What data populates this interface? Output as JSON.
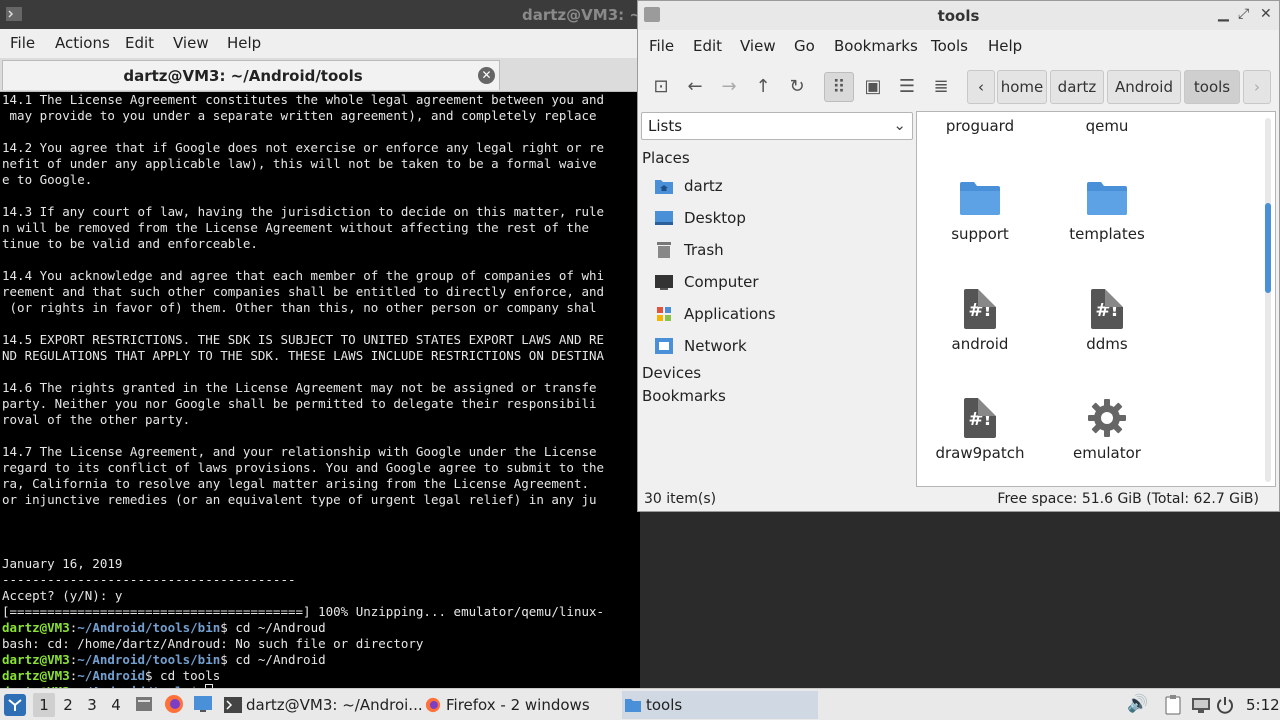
{
  "terminal": {
    "title": "dartz@VM3: ~",
    "menu": [
      "File",
      "Actions",
      "Edit",
      "View",
      "Help"
    ],
    "tab_label": "dartz@VM3: ~/Android/tools",
    "lines": [
      "14.1 The License Agreement constitutes the whole legal agreement between you and",
      " may provide to you under a separate written agreement), and completely replace",
      "",
      "14.2 You agree that if Google does not exercise or enforce any legal right or re",
      "nefit of under any applicable law), this will not be taken to be a formal waive",
      "e to Google.",
      "",
      "14.3 If any court of law, having the jurisdiction to decide on this matter, rule",
      "n will be removed from the License Agreement without affecting the rest of the",
      "tinue to be valid and enforceable.",
      "",
      "14.4 You acknowledge and agree that each member of the group of companies of whi",
      "reement and that such other companies shall be entitled to directly enforce, and",
      " (or rights in favor of) them. Other than this, no other person or company shal",
      "",
      "14.5 EXPORT RESTRICTIONS. THE SDK IS SUBJECT TO UNITED STATES EXPORT LAWS AND RE",
      "ND REGULATIONS THAT APPLY TO THE SDK. THESE LAWS INCLUDE RESTRICTIONS ON DESTINA",
      "",
      "14.6 The rights granted in the License Agreement may not be assigned or transfe",
      "party. Neither you nor Google shall be permitted to delegate their responsibili",
      "roval of the other party.",
      "",
      "14.7 The License Agreement, and your relationship with Google under the License",
      "regard to its conflict of laws provisions. You and Google agree to submit to the",
      "ra, California to resolve any legal matter arising from the License Agreement.",
      "or injunctive remedies (or an equivalent type of urgent legal relief) in any ju",
      "",
      "",
      "",
      "January 16, 2019",
      "---------------------------------------",
      "Accept? (y/N): y",
      "[=======================================] 100% Unzipping... emulator/qemu/linux-"
    ],
    "prompt_user": "dartz@VM3",
    "prompts": [
      {
        "path": "~/Android/tools/bin",
        "cmd": " cd ~/Androud"
      },
      {
        "path": "",
        "cmd": "bash: cd: /home/dartz/Androud: No such file or directory",
        "plain": true
      },
      {
        "path": "~/Android/tools/bin",
        "cmd": " cd ~/Android"
      },
      {
        "path": "~/Android",
        "cmd": " cd tools"
      },
      {
        "path": "~/Android/tools",
        "cmd": " "
      }
    ]
  },
  "filemanager": {
    "title": "tools",
    "menu": [
      "File",
      "Edit",
      "View",
      "Go",
      "Bookmarks",
      "Tools",
      "Help"
    ],
    "breadcrumbs": [
      "home",
      "dartz",
      "Android",
      "tools"
    ],
    "sidebar_view": "Lists",
    "sections": {
      "places": "Places",
      "devices": "Devices",
      "bookmarks": "Bookmarks"
    },
    "places": [
      "dartz",
      "Desktop",
      "Trash",
      "Computer",
      "Applications",
      "Network"
    ],
    "items": [
      {
        "name": "proguard",
        "kind": "folder"
      },
      {
        "name": "qemu",
        "kind": "folder"
      },
      {
        "name": "support",
        "kind": "folder"
      },
      {
        "name": "templates",
        "kind": "folder"
      },
      {
        "name": "android",
        "kind": "script"
      },
      {
        "name": "ddms",
        "kind": "script"
      },
      {
        "name": "draw9patch",
        "kind": "script"
      },
      {
        "name": "emulator",
        "kind": "gear"
      }
    ],
    "script_glyph": "#!",
    "status_count": "30 item(s)",
    "status_space": "Free space: 51.6 GiB (Total: 62.7 GiB)"
  },
  "taskbar": {
    "workspaces": [
      "1",
      "2",
      "3",
      "4"
    ],
    "tasks": [
      {
        "label": "dartz@VM3: ~/Androi...",
        "icon": "terminal-icon"
      },
      {
        "label": "Firefox - 2 windows",
        "icon": "firefox-icon"
      },
      {
        "label": "tools",
        "icon": "folder-icon"
      }
    ],
    "clock": "5:12"
  },
  "colors": {
    "accent": "#4a90d9",
    "prompt_user": "#8ae234",
    "prompt_path": "#729fcf"
  }
}
